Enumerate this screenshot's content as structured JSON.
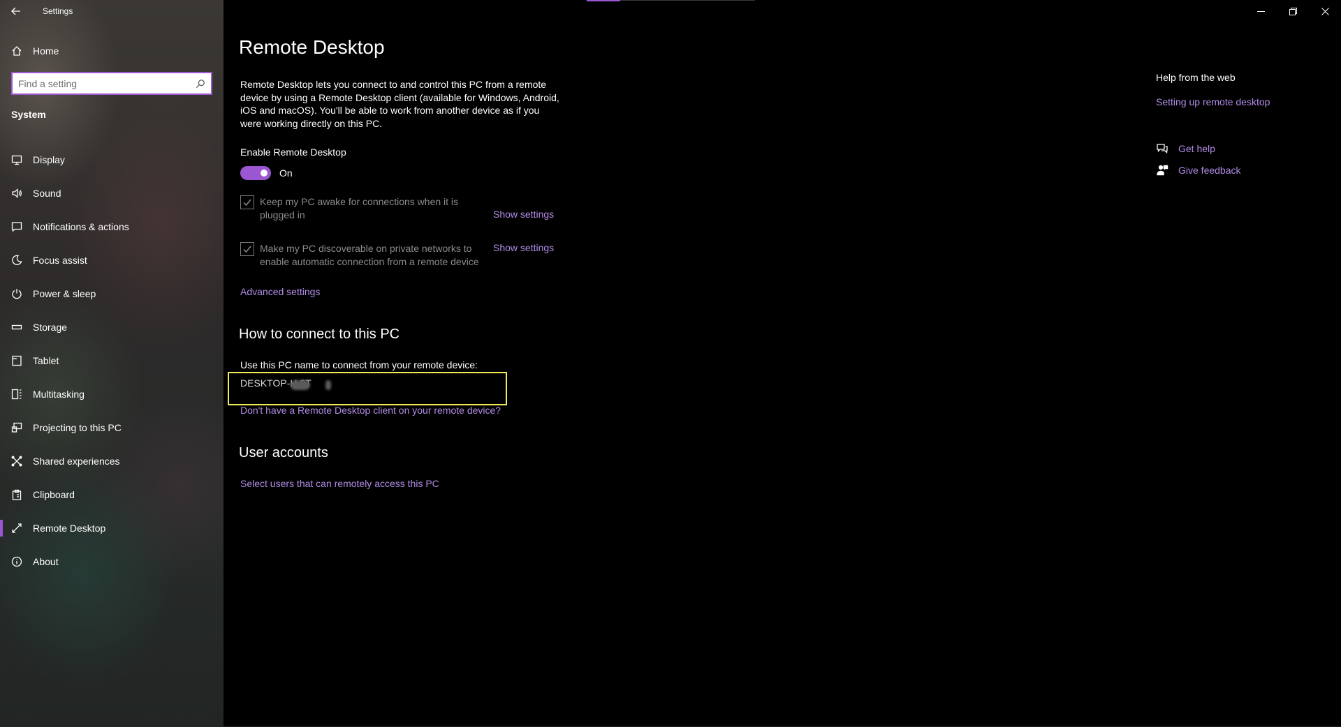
{
  "window": {
    "app_title": "Settings"
  },
  "sidebar": {
    "home_label": "Home",
    "search_placeholder": "Find a setting",
    "section_heading": "System",
    "items": [
      {
        "label": "Display",
        "icon": "display-icon"
      },
      {
        "label": "Sound",
        "icon": "speaker-icon"
      },
      {
        "label": "Notifications & actions",
        "icon": "notification-icon"
      },
      {
        "label": "Focus assist",
        "icon": "moon-icon"
      },
      {
        "label": "Power & sleep",
        "icon": "power-icon"
      },
      {
        "label": "Storage",
        "icon": "storage-icon"
      },
      {
        "label": "Tablet",
        "icon": "tablet-icon"
      },
      {
        "label": "Multitasking",
        "icon": "multitasking-icon"
      },
      {
        "label": "Projecting to this PC",
        "icon": "projecting-icon"
      },
      {
        "label": "Shared experiences",
        "icon": "shared-experiences-icon"
      },
      {
        "label": "Clipboard",
        "icon": "clipboard-icon"
      },
      {
        "label": "Remote Desktop",
        "icon": "remote-desktop-icon",
        "selected": true
      },
      {
        "label": "About",
        "icon": "info-icon"
      }
    ]
  },
  "main": {
    "title": "Remote Desktop",
    "description": "Remote Desktop lets you connect to and control this PC from a remote device by using a Remote Desktop client (available for Windows, Android, iOS and macOS). You'll be able to work from another device as if you were working directly on this PC.",
    "enable_label": "Enable Remote Desktop",
    "toggle_state": "On",
    "toggle_on": true,
    "checkbox_awake": {
      "label": "Keep my PC awake for connections when it is plugged in",
      "checked": true,
      "link": "Show settings"
    },
    "checkbox_discoverable": {
      "label": "Make my PC discoverable on private networks to enable automatic connection from a remote device",
      "checked": true,
      "link": "Show settings"
    },
    "advanced_link": "Advanced settings",
    "connect_heading": "How to connect to this PC",
    "pc_name_label": "Use this PC name to connect from your remote device:",
    "pc_name": "DESKTOP-H   3T",
    "no_client_link": "Don't have a Remote Desktop client on your remote device?",
    "user_accounts_heading": "User accounts",
    "select_users_link": "Select users that can remotely access this PC"
  },
  "help": {
    "title": "Help from the web",
    "link": "Setting up remote desktop",
    "get_help": "Get help",
    "give_feedback": "Give feedback"
  },
  "colors": {
    "accent": "#9a57d1",
    "link": "#b28ce6",
    "highlight_box": "#f2ec58",
    "background": "#000000"
  }
}
